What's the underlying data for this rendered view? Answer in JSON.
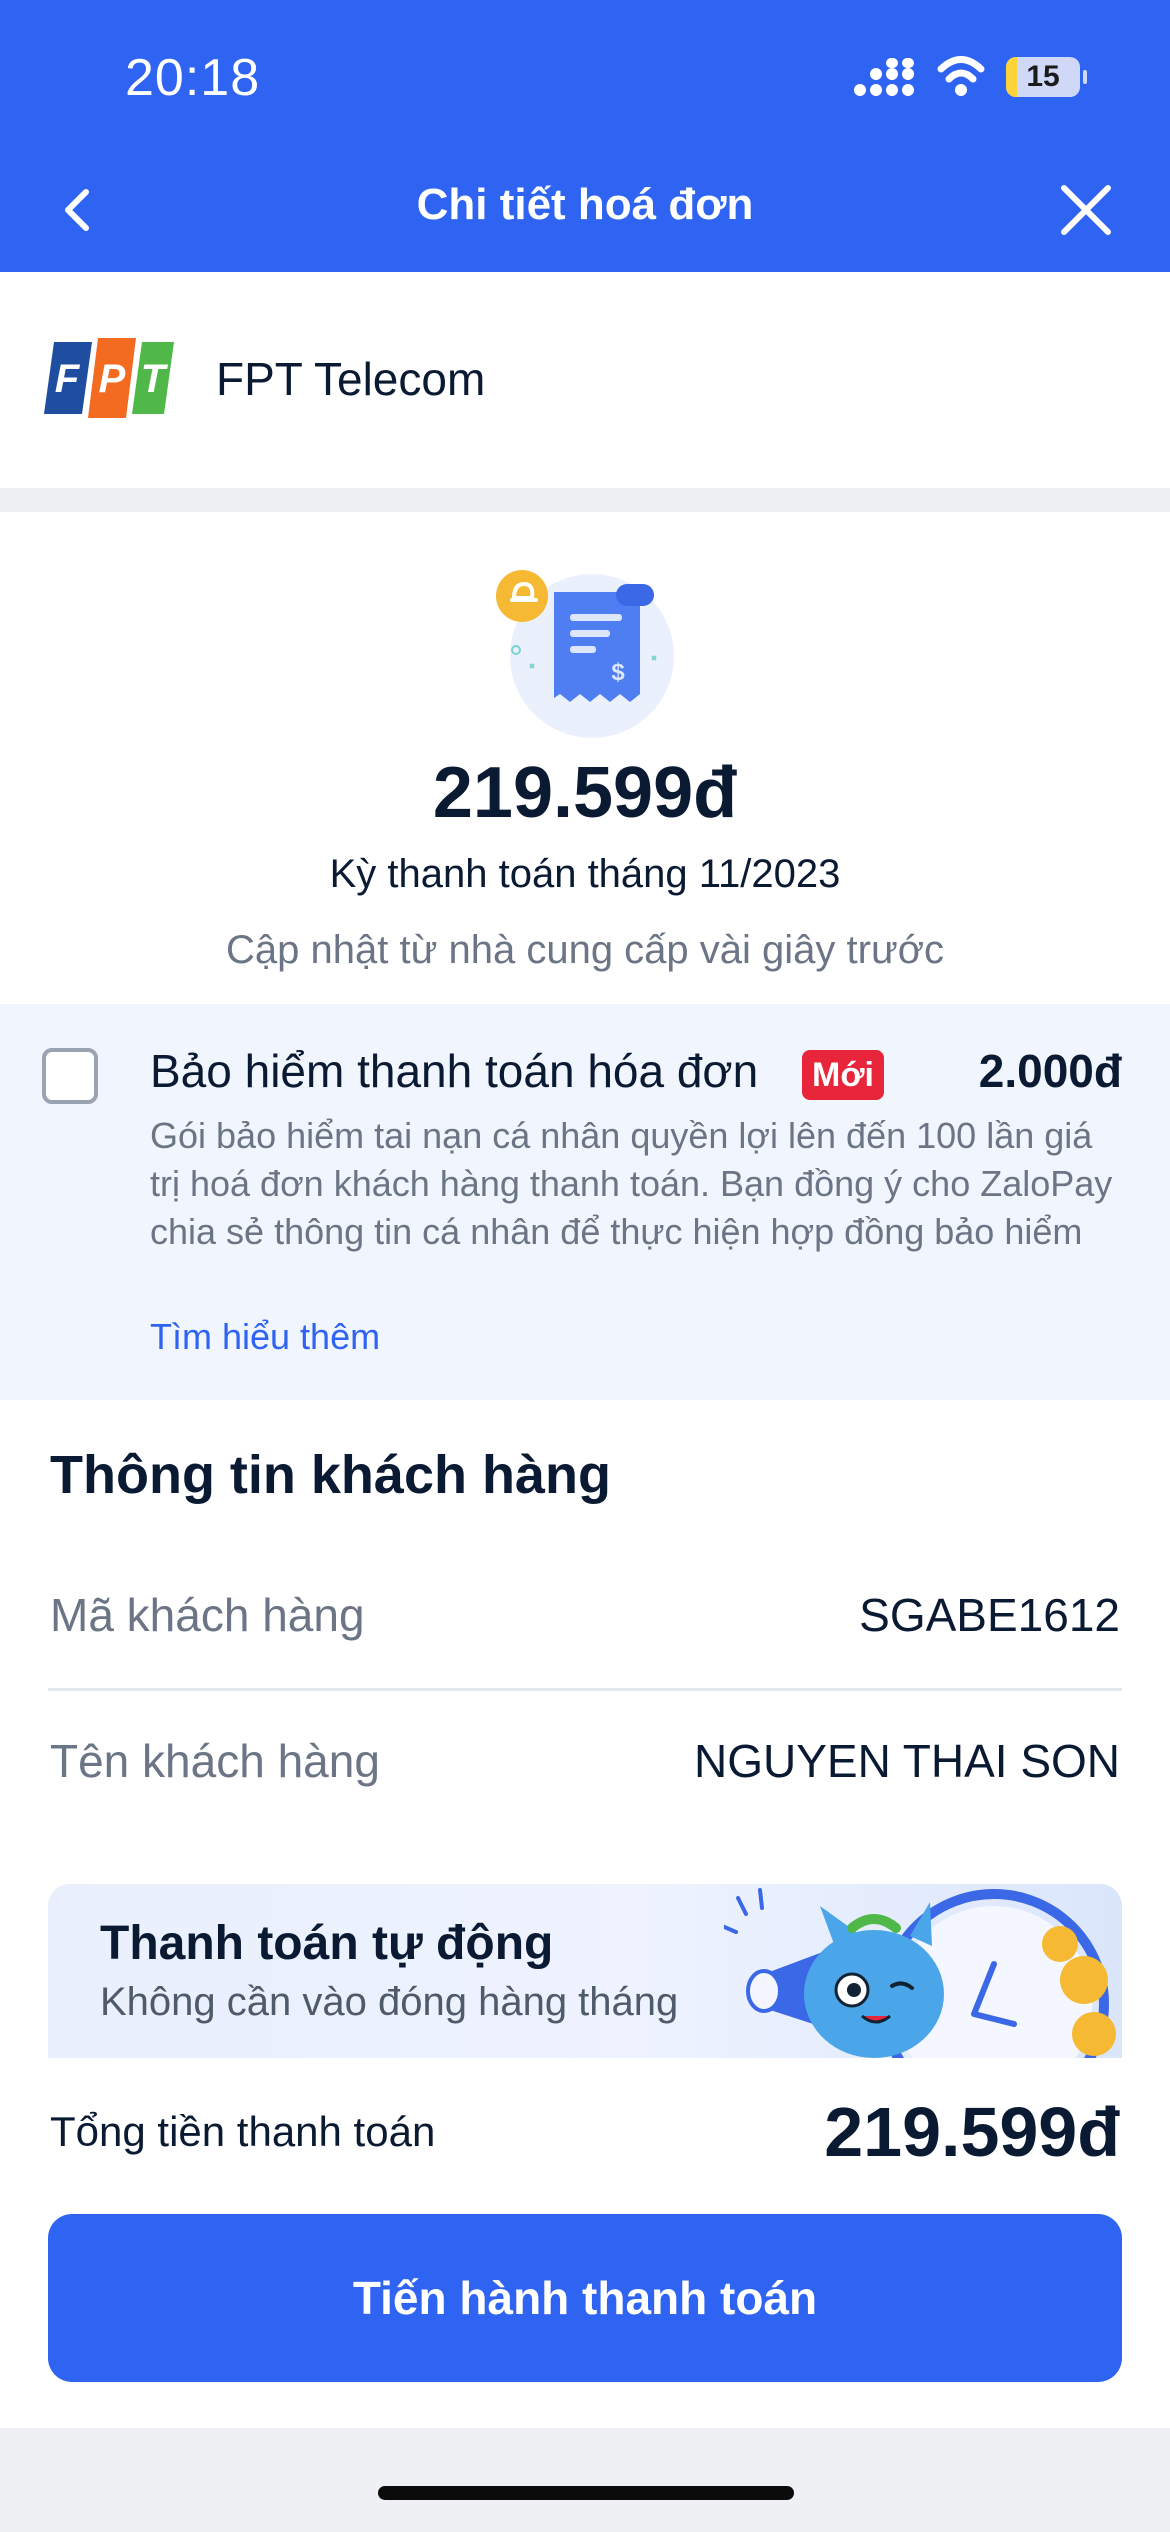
{
  "status_bar": {
    "time": "20:18",
    "battery": "15",
    "battery_level": 0.15
  },
  "header": {
    "title": "Chi tiết hoá đơn"
  },
  "provider": {
    "name": "FPT Telecom",
    "logo_letters": [
      "F",
      "P",
      "T"
    ]
  },
  "bill": {
    "amount": "219.599đ",
    "period": "Kỳ thanh toán tháng 11/2023",
    "updated": "Cập nhật từ nhà cung cấp vài giây trước"
  },
  "insurance": {
    "title": "Bảo hiểm thanh toán hóa đơn",
    "badge": "Mới",
    "price": "2.000đ",
    "description": "Gói bảo hiểm tai nạn cá nhân quyền lợi lên đến 100 lần giá trị hoá đơn khách hàng thanh toán. Bạn đồng ý cho ZaloPay chia sẻ thông tin cá nhân để thực hiện hợp đồng bảo hiểm",
    "learn_more": "Tìm hiểu thêm",
    "checked": false
  },
  "customer": {
    "section_title": "Thông tin khách hàng",
    "rows": [
      {
        "label": "Mã khách hàng",
        "value": "SGABE1612"
      },
      {
        "label": "Tên khách hàng",
        "value": "NGUYEN THAI SON"
      }
    ]
  },
  "promo": {
    "title": "Thanh toán tự động",
    "subtitle": "Không cần vào đóng hàng tháng"
  },
  "footer": {
    "total_label": "Tổng tiền thanh toán",
    "total_value": "219.599đ",
    "pay_button": "Tiến hành thanh toán"
  },
  "colors": {
    "primary": "#2f63f2",
    "badge_red": "#e8253a",
    "fpt_blue": "#1f4ea1",
    "fpt_orange": "#f26b21",
    "fpt_green": "#4fb848"
  }
}
